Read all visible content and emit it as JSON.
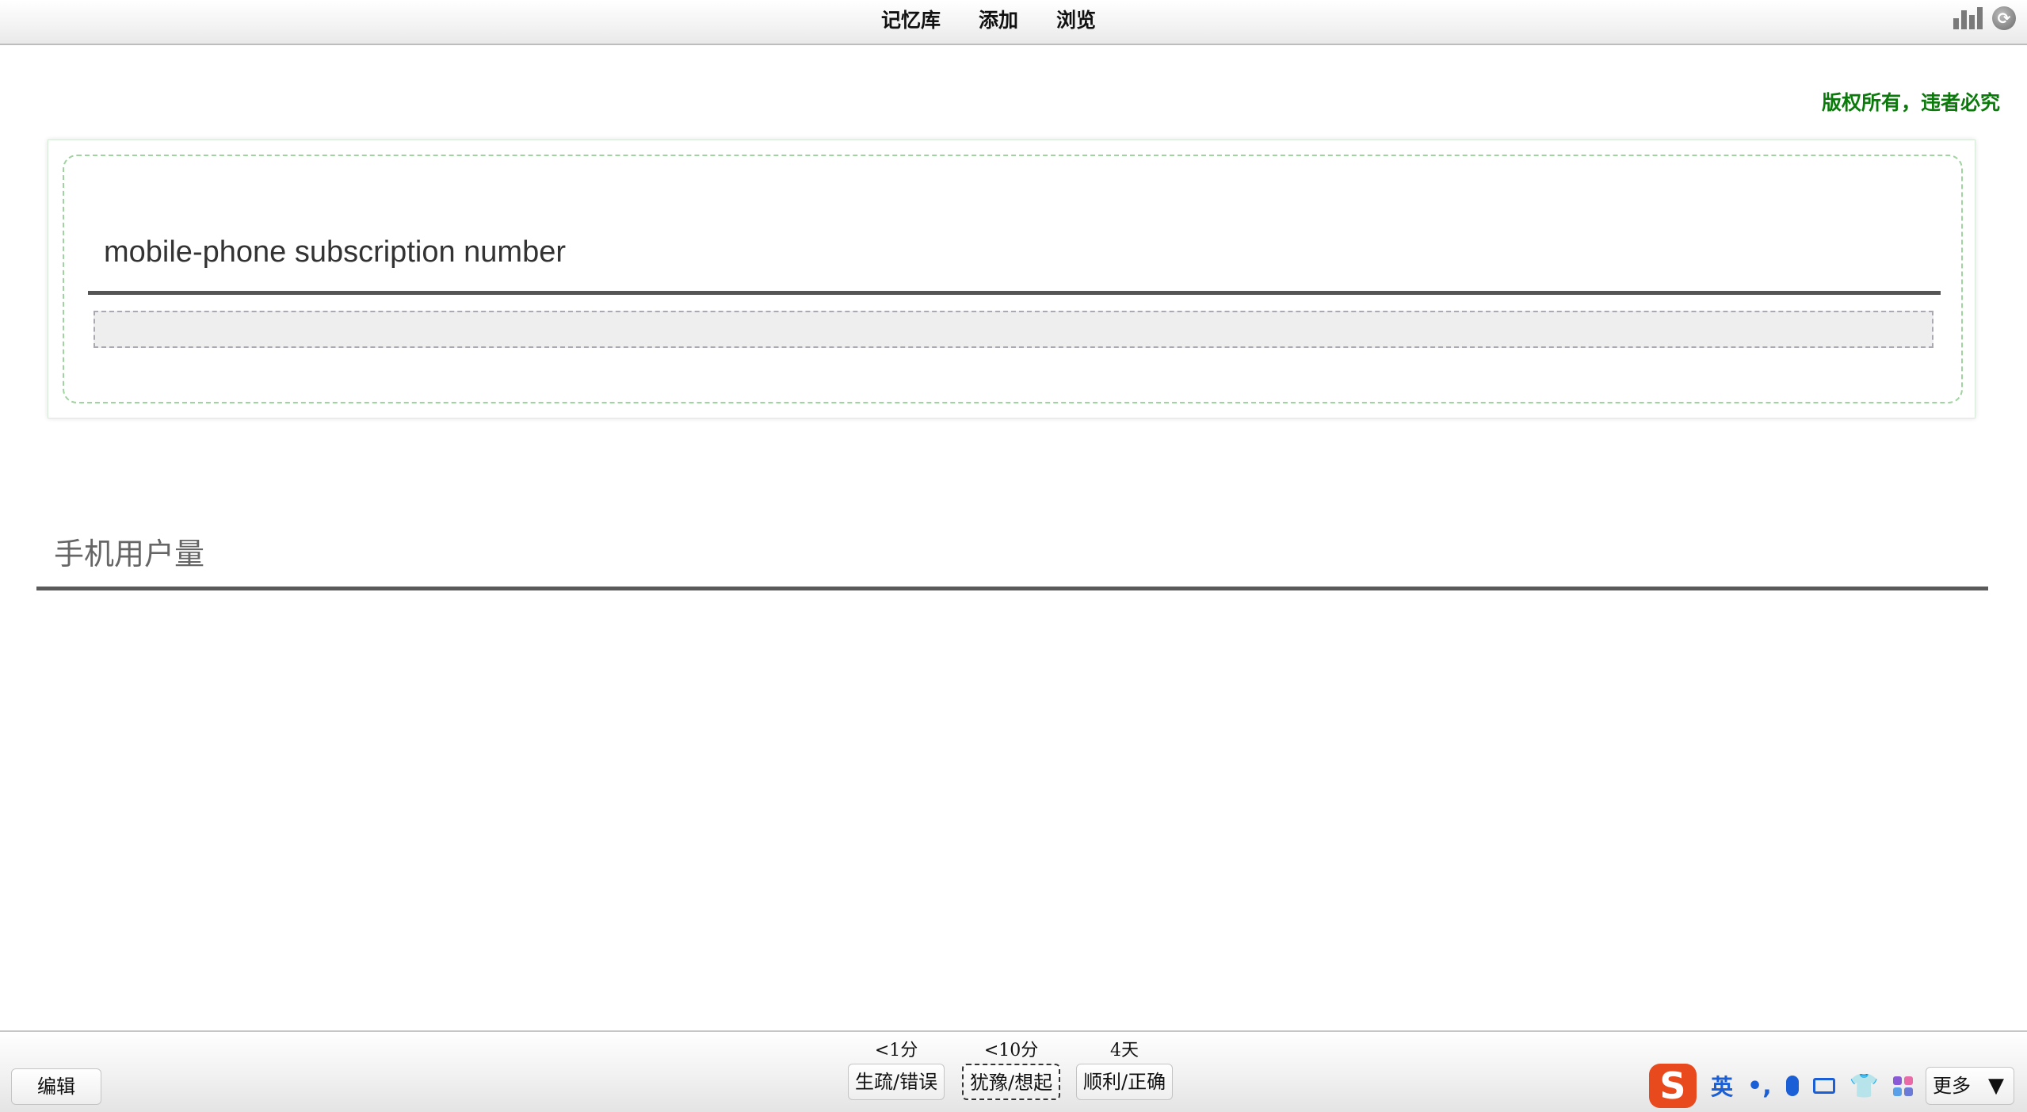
{
  "nav": {
    "items": [
      "记忆库",
      "添加",
      "浏览"
    ]
  },
  "top_icons": [
    "stats-icon",
    "sync-icon"
  ],
  "copyright": "版权所有，违者必究",
  "card": {
    "question": "mobile-phone subscription number",
    "answer_input_value": ""
  },
  "answer": "手机用户量",
  "bottom": {
    "edit_label": "编辑",
    "grades": [
      {
        "time": "<1分",
        "label": "生疏/错误"
      },
      {
        "time": "<10分",
        "label": "犹豫/想起"
      },
      {
        "time": "4天",
        "label": "顺利/正确"
      }
    ],
    "more_label": "更多",
    "more_arrow": "▼"
  },
  "ime": {
    "logo": "S",
    "mode": "英",
    "punct": "•,"
  },
  "colors": {
    "copyright": "#0a7a0a",
    "card_border": "#9fd39f",
    "ime_blue": "#1b5fd6",
    "ime_logo": "#e8491d"
  }
}
